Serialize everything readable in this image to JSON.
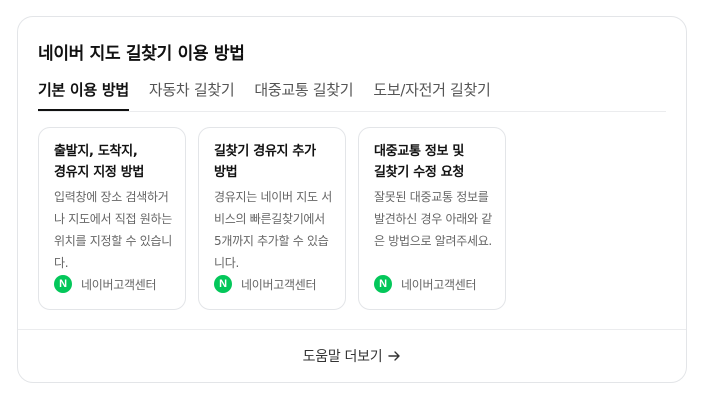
{
  "panel": {
    "title": "네이버 지도 길찾기 이용 방법"
  },
  "tabs": [
    {
      "label": "기본 이용 방법",
      "active": true
    },
    {
      "label": "자동차 길찾기",
      "active": false
    },
    {
      "label": "대중교통 길찾기",
      "active": false
    },
    {
      "label": "도보/자전거 길찾기",
      "active": false
    }
  ],
  "cards": [
    {
      "title": "출발지, 도착지, 경유지 지정 방법",
      "desc": "입력창에 장소 검색하거나 지도에서 직접 원하는 위치를 지정할 수 있습니다.",
      "source_icon": "N",
      "source": "네이버고객센터"
    },
    {
      "title": "길찾기 경유지 추가 방법",
      "desc": "경유지는 네이버 지도 서비스의 빠른길찾기에서 5개까지 추가할 수 있습니다.",
      "source_icon": "N",
      "source": "네이버고객센터"
    },
    {
      "title": "대중교통 정보 및 길찾기 수정 요청",
      "desc": "잘못된 대중교통 정보를 발견하신 경우 아래와 같은 방법으로 알려주세요.",
      "source_icon": "N",
      "source": "네이버고객센터"
    }
  ],
  "footer": {
    "more_label": "도움말 더보기"
  },
  "colors": {
    "naver_green": "#03c75a",
    "border": "#e3e5e8"
  }
}
